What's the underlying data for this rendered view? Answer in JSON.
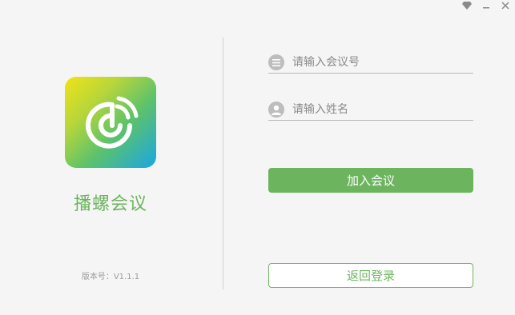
{
  "window": {
    "controls": {
      "skin_icon": "diamond-icon",
      "minimize_icon": "minimize-icon",
      "close_icon": "close-icon"
    }
  },
  "brand": {
    "logo_icon": "snail-signal-logo-icon",
    "app_name": "播螺会议",
    "version": "版本号：V1.1.1",
    "accent_color": "#6db45f"
  },
  "form": {
    "meeting_id": {
      "placeholder": "请输入会议号",
      "value": "",
      "icon": "list-icon"
    },
    "name": {
      "placeholder": "请输入姓名",
      "value": "",
      "icon": "user-icon"
    },
    "join_label": "加入会议",
    "back_label": "返回登录"
  }
}
